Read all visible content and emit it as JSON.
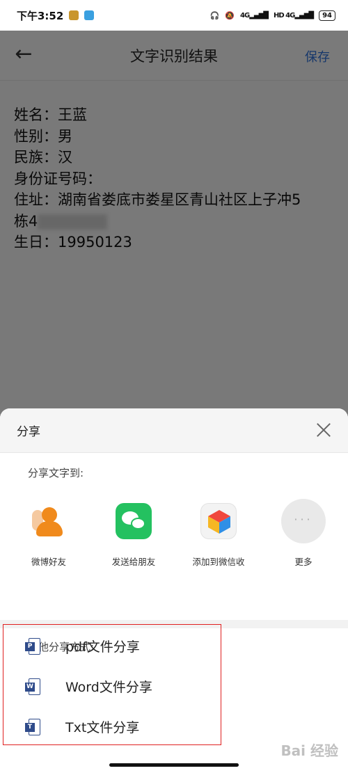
{
  "status_bar": {
    "time": "下午3:52",
    "signal_left": "4G",
    "hd": "HD",
    "signal_right": "4G",
    "battery": "94"
  },
  "nav": {
    "title": "文字识别结果",
    "save_label": "保存"
  },
  "result_lines": [
    "姓名：王蓝",
    "性别：男",
    "民族：汉",
    "身份证号码：",
    "住址：湖南省娄底市娄星区青山社区上子冲5",
    "栋4",
    "生日：19950123"
  ],
  "share": {
    "title": "分享",
    "section_text": "分享文字到:",
    "apps": [
      {
        "label": "微博好友",
        "icon": "weibo-friends-icon"
      },
      {
        "label": "发送给朋友",
        "icon": "wechat-icon"
      },
      {
        "label": "添加到微信收",
        "icon": "wechat-favorites-icon"
      },
      {
        "label": "更多",
        "icon": "more-dots-icon"
      }
    ],
    "section_other": "其他分享方式:",
    "options": [
      {
        "label": "pdf文件分享",
        "icon_letter": "P"
      },
      {
        "label": "Word文件分享",
        "icon_letter": "W"
      },
      {
        "label": "Txt文件分享",
        "icon_letter": "T"
      }
    ],
    "highlight_color": "#e02020"
  },
  "watermark": "Bai 经验"
}
